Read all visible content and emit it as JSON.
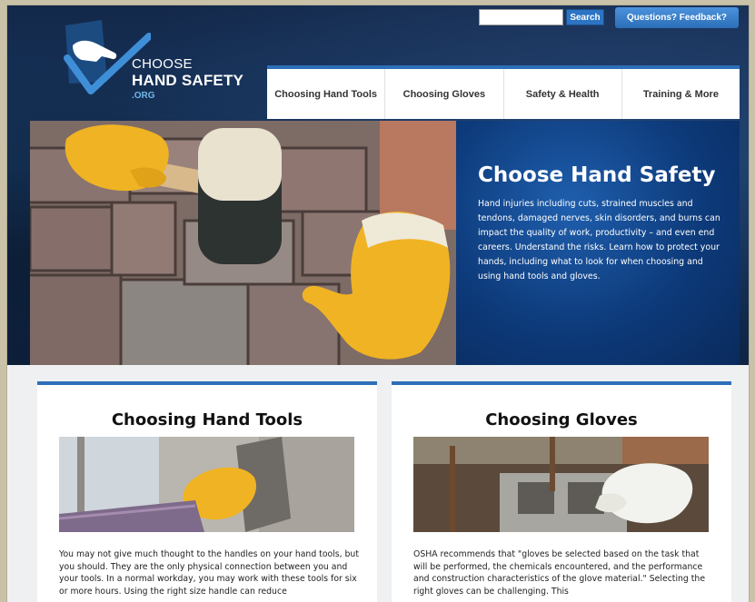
{
  "logo": {
    "line1": "CHOOSE",
    "line2": "HAND SAFETY",
    "line3": ".ORG"
  },
  "search": {
    "value": "",
    "button_label": "Search"
  },
  "feedback_label": "Questions? Feedback?",
  "nav": [
    {
      "label": "Choosing Hand Tools"
    },
    {
      "label": "Choosing Gloves"
    },
    {
      "label": "Safety & Health"
    },
    {
      "label": "Training & More"
    }
  ],
  "hero": {
    "title": "Choose Hand Safety",
    "text": "Hand injuries including cuts, strained muscles and tendons, damaged nerves, skin disorders, and burns can impact the quality of work, productivity – and even end careers. Understand the risks. Learn how to protect your hands, including what to look for when choosing and using hand tools and gloves."
  },
  "cards": [
    {
      "title": "Choosing Hand Tools",
      "text": "You may not give much thought to the handles on your hand tools, but you should. They are the only physical connection between you and your tools. In a normal workday, you may work with these tools for six or more hours. Using the right size handle can reduce"
    },
    {
      "title": "Choosing Gloves",
      "text": "OSHA recommends that \"gloves be selected based on the task that will be performed, the chemicals encountered, and the performance and construction characteristics of the glove material.\" Selecting the right gloves can be challenging. This"
    }
  ],
  "colors": {
    "brand_blue": "#2c6fb8",
    "header_navy": "#13284a",
    "glove_yellow": "#f0b323"
  }
}
